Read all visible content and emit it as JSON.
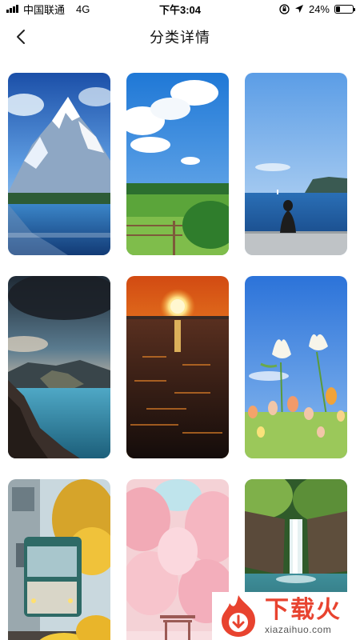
{
  "status_bar": {
    "carrier": "中国联通",
    "network": "4G",
    "time": "下午3:04",
    "battery": "24%",
    "battery_level": 0.24
  },
  "header": {
    "title": "分类详情",
    "back_icon": "chevron-left-icon"
  },
  "wallpapers": [
    {
      "subject": "snowy-mountain-lake"
    },
    {
      "subject": "green-meadow-blue-sky"
    },
    {
      "subject": "girl-by-sea"
    },
    {
      "subject": "mountain-crater-lake"
    },
    {
      "subject": "sunset-over-sea"
    },
    {
      "subject": "white-tulips"
    },
    {
      "subject": "tram-yellow-flowers"
    },
    {
      "subject": "pink-cherry-blossoms"
    },
    {
      "subject": "forest-waterfall"
    }
  ],
  "watermark": {
    "title": "下载火",
    "subtitle": "xiazaihuo.com"
  },
  "colors": {
    "accent": "#e8432f",
    "background": "#ffffff"
  }
}
